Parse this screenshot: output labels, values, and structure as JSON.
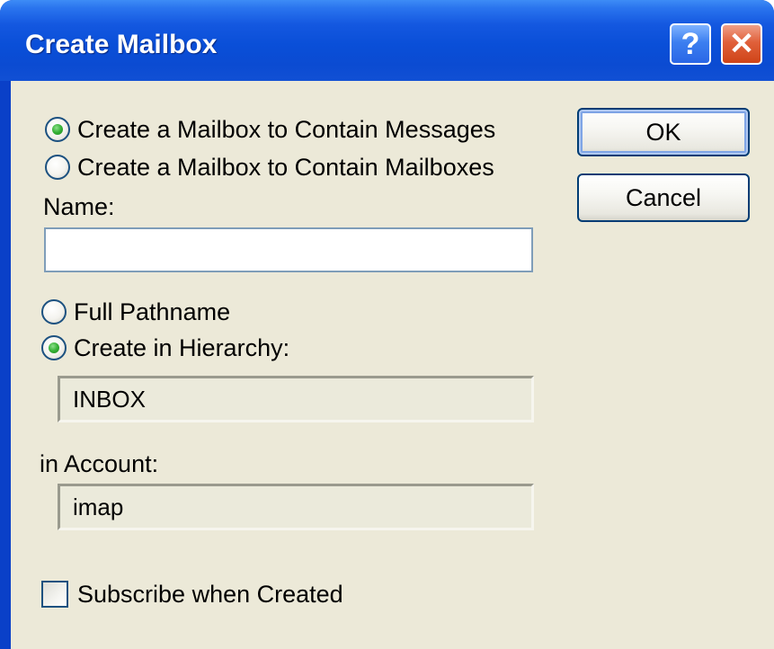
{
  "window": {
    "title": "Create Mailbox",
    "help_glyph": "?",
    "close_glyph": "✕"
  },
  "mailbox_type": {
    "options": [
      {
        "label": "Create a Mailbox to Contain Messages",
        "selected": true
      },
      {
        "label": "Create a Mailbox to Contain Mailboxes",
        "selected": false
      }
    ]
  },
  "name": {
    "label": "Name:",
    "value": ""
  },
  "location": {
    "options": [
      {
        "label": "Full Pathname",
        "selected": false
      },
      {
        "label": "Create in Hierarchy:",
        "selected": true
      }
    ],
    "hierarchy_value": "INBOX"
  },
  "account": {
    "label": "in Account:",
    "value": "imap"
  },
  "subscribe": {
    "label": "Subscribe when Created",
    "checked": false
  },
  "buttons": {
    "ok_label": "OK",
    "cancel_label": "Cancel"
  },
  "colors": {
    "titlebar": "#0a4fd8",
    "dialog_bg": "#ece9d8",
    "radio_selected": "#35b035",
    "close_button": "#e0603a",
    "help_button": "#3c7ff0"
  },
  "icons": {
    "help": "help-icon",
    "close": "close-icon"
  }
}
